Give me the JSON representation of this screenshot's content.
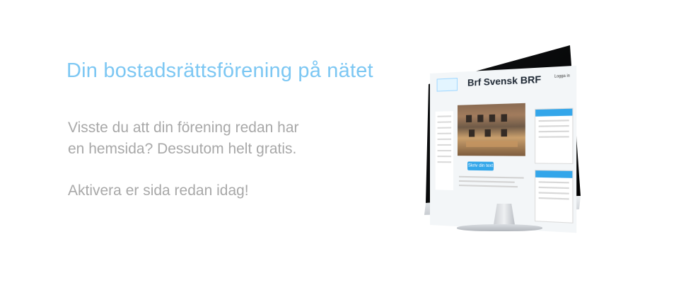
{
  "hero": {
    "title": "Din bostadsrättsförening på nätet",
    "text_line1": "Visste du att din förening redan har",
    "text_line2": "en hemsida? Dessutom helt gratis.",
    "text_line3": "Aktivera er sida redan idag!"
  },
  "monitor": {
    "site_title": "Brf Svensk BRF",
    "login_label": "Logga in",
    "cta_label": "Skriv din text"
  },
  "colors": {
    "accent": "#7cc7f3",
    "body_text": "#a8a8a8",
    "card_header": "#33a6ea"
  }
}
